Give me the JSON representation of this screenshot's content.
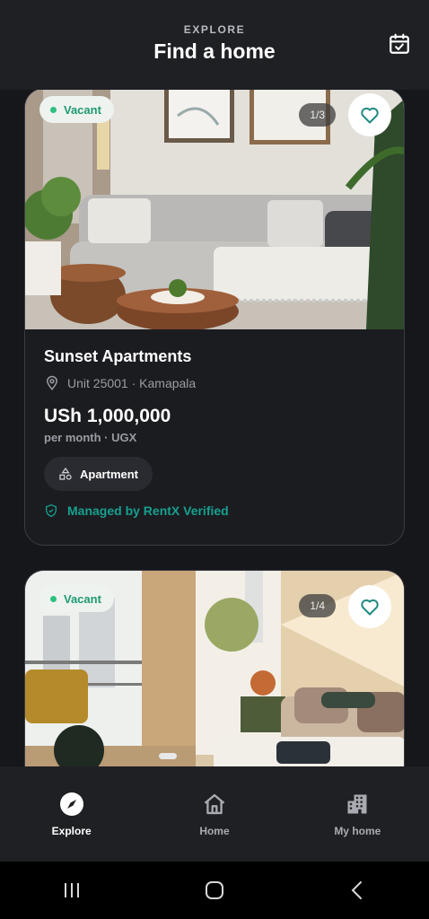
{
  "header": {
    "eyebrow": "EXPLORE",
    "title": "Find a home",
    "calendar_icon": "calendar-check-icon"
  },
  "listings": [
    {
      "status": "Vacant",
      "photo_counter": "1/3",
      "name": "Sunset Apartments",
      "location": "Unit 25001 · Kamapala",
      "price": "USh 1,000,000",
      "period": "per month · UGX",
      "type": "Apartment",
      "managed": "Managed by RentX Verified"
    },
    {
      "status": "Vacant",
      "photo_counter": "1/4"
    }
  ],
  "nav": [
    {
      "label": "Explore",
      "icon": "compass-icon",
      "active": true
    },
    {
      "label": "Home",
      "icon": "home-icon",
      "active": false
    },
    {
      "label": "My home",
      "icon": "building-icon",
      "active": false
    }
  ],
  "colors": {
    "background": "#16171b",
    "accent": "#16a08f",
    "vacant": "#1f9a73",
    "card": "#1b1c20"
  }
}
